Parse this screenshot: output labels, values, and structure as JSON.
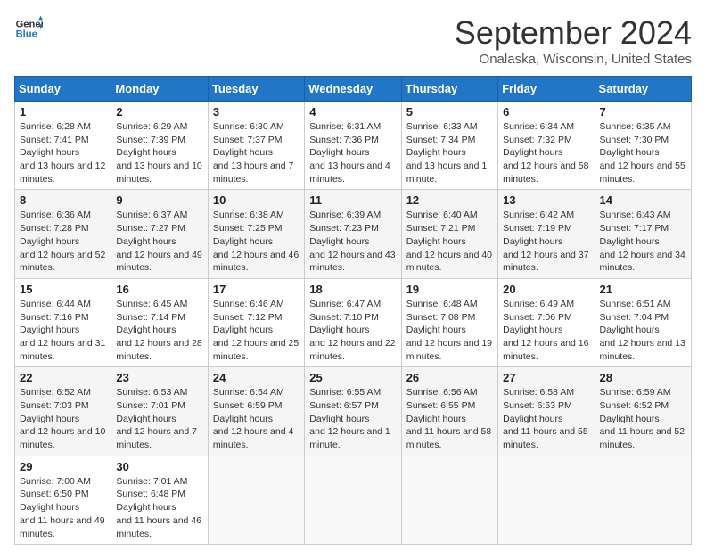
{
  "header": {
    "logo_line1": "General",
    "logo_line2": "Blue",
    "month": "September 2024",
    "location": "Onalaska, Wisconsin, United States"
  },
  "days_of_week": [
    "Sunday",
    "Monday",
    "Tuesday",
    "Wednesday",
    "Thursday",
    "Friday",
    "Saturday"
  ],
  "weeks": [
    [
      {
        "num": "1",
        "sunrise": "6:28 AM",
        "sunset": "7:41 PM",
        "daylight": "13 hours and 12 minutes."
      },
      {
        "num": "2",
        "sunrise": "6:29 AM",
        "sunset": "7:39 PM",
        "daylight": "13 hours and 10 minutes."
      },
      {
        "num": "3",
        "sunrise": "6:30 AM",
        "sunset": "7:37 PM",
        "daylight": "13 hours and 7 minutes."
      },
      {
        "num": "4",
        "sunrise": "6:31 AM",
        "sunset": "7:36 PM",
        "daylight": "13 hours and 4 minutes."
      },
      {
        "num": "5",
        "sunrise": "6:33 AM",
        "sunset": "7:34 PM",
        "daylight": "13 hours and 1 minute."
      },
      {
        "num": "6",
        "sunrise": "6:34 AM",
        "sunset": "7:32 PM",
        "daylight": "12 hours and 58 minutes."
      },
      {
        "num": "7",
        "sunrise": "6:35 AM",
        "sunset": "7:30 PM",
        "daylight": "12 hours and 55 minutes."
      }
    ],
    [
      {
        "num": "8",
        "sunrise": "6:36 AM",
        "sunset": "7:28 PM",
        "daylight": "12 hours and 52 minutes."
      },
      {
        "num": "9",
        "sunrise": "6:37 AM",
        "sunset": "7:27 PM",
        "daylight": "12 hours and 49 minutes."
      },
      {
        "num": "10",
        "sunrise": "6:38 AM",
        "sunset": "7:25 PM",
        "daylight": "12 hours and 46 minutes."
      },
      {
        "num": "11",
        "sunrise": "6:39 AM",
        "sunset": "7:23 PM",
        "daylight": "12 hours and 43 minutes."
      },
      {
        "num": "12",
        "sunrise": "6:40 AM",
        "sunset": "7:21 PM",
        "daylight": "12 hours and 40 minutes."
      },
      {
        "num": "13",
        "sunrise": "6:42 AM",
        "sunset": "7:19 PM",
        "daylight": "12 hours and 37 minutes."
      },
      {
        "num": "14",
        "sunrise": "6:43 AM",
        "sunset": "7:17 PM",
        "daylight": "12 hours and 34 minutes."
      }
    ],
    [
      {
        "num": "15",
        "sunrise": "6:44 AM",
        "sunset": "7:16 PM",
        "daylight": "12 hours and 31 minutes."
      },
      {
        "num": "16",
        "sunrise": "6:45 AM",
        "sunset": "7:14 PM",
        "daylight": "12 hours and 28 minutes."
      },
      {
        "num": "17",
        "sunrise": "6:46 AM",
        "sunset": "7:12 PM",
        "daylight": "12 hours and 25 minutes."
      },
      {
        "num": "18",
        "sunrise": "6:47 AM",
        "sunset": "7:10 PM",
        "daylight": "12 hours and 22 minutes."
      },
      {
        "num": "19",
        "sunrise": "6:48 AM",
        "sunset": "7:08 PM",
        "daylight": "12 hours and 19 minutes."
      },
      {
        "num": "20",
        "sunrise": "6:49 AM",
        "sunset": "7:06 PM",
        "daylight": "12 hours and 16 minutes."
      },
      {
        "num": "21",
        "sunrise": "6:51 AM",
        "sunset": "7:04 PM",
        "daylight": "12 hours and 13 minutes."
      }
    ],
    [
      {
        "num": "22",
        "sunrise": "6:52 AM",
        "sunset": "7:03 PM",
        "daylight": "12 hours and 10 minutes."
      },
      {
        "num": "23",
        "sunrise": "6:53 AM",
        "sunset": "7:01 PM",
        "daylight": "12 hours and 7 minutes."
      },
      {
        "num": "24",
        "sunrise": "6:54 AM",
        "sunset": "6:59 PM",
        "daylight": "12 hours and 4 minutes."
      },
      {
        "num": "25",
        "sunrise": "6:55 AM",
        "sunset": "6:57 PM",
        "daylight": "12 hours and 1 minute."
      },
      {
        "num": "26",
        "sunrise": "6:56 AM",
        "sunset": "6:55 PM",
        "daylight": "11 hours and 58 minutes."
      },
      {
        "num": "27",
        "sunrise": "6:58 AM",
        "sunset": "6:53 PM",
        "daylight": "11 hours and 55 minutes."
      },
      {
        "num": "28",
        "sunrise": "6:59 AM",
        "sunset": "6:52 PM",
        "daylight": "11 hours and 52 minutes."
      }
    ],
    [
      {
        "num": "29",
        "sunrise": "7:00 AM",
        "sunset": "6:50 PM",
        "daylight": "11 hours and 49 minutes."
      },
      {
        "num": "30",
        "sunrise": "7:01 AM",
        "sunset": "6:48 PM",
        "daylight": "11 hours and 46 minutes."
      },
      null,
      null,
      null,
      null,
      null
    ]
  ]
}
